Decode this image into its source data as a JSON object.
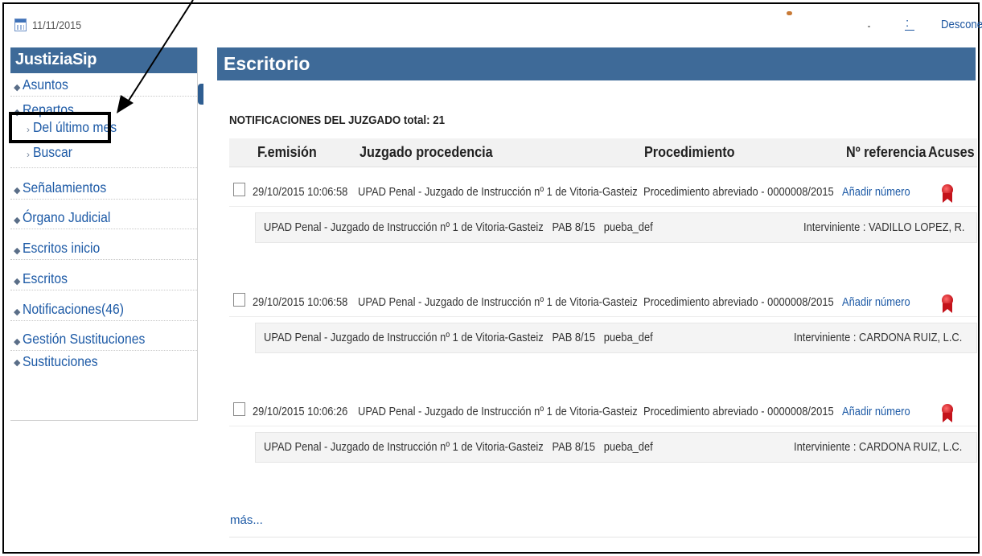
{
  "topbar": {
    "date": "11/11/2015",
    "link_short": ":",
    "logout": "Desconec"
  },
  "sidebar": {
    "title": "JustiziaSip",
    "items": [
      {
        "label": "Asuntos"
      },
      {
        "label": "Repartos"
      },
      {
        "label": "Señalamientos"
      },
      {
        "label": "Órgano Judicial"
      },
      {
        "label": "Escritos inicio"
      },
      {
        "label": "Escritos"
      },
      {
        "label": "Notificaciones(46)"
      },
      {
        "label": "Gestión Sustituciones"
      },
      {
        "label": "Sustituciones"
      }
    ],
    "subitems": [
      {
        "label": "Del último mes"
      },
      {
        "label": "Buscar"
      }
    ]
  },
  "main": {
    "title": "Escritorio",
    "section_title": "NOTIFICACIONES DEL JUZGADO total: 21",
    "columns": [
      "F.emisión",
      "Juzgado procedencia",
      "Procedimiento",
      "Nº referencia",
      "Acuses"
    ],
    "notifications": [
      {
        "date": "29/10/2015 10:06:58",
        "court": "UPAD Penal - Juzgado de Instrucción nº 1 de Vitoria-Gasteiz",
        "procedure": "Procedimiento abreviado - 0000008/2015",
        "reference": "Añadir número",
        "detail": "UPAD Penal - Juzgado de Instrucción nº 1 de Vitoria-Gasteiz   PAB 8/15   pueba_def",
        "participant": "Interviniente : VADILLO LOPEZ, R."
      },
      {
        "date": "29/10/2015 10:06:58",
        "court": "UPAD Penal - Juzgado de Instrucción nº 1 de Vitoria-Gasteiz",
        "procedure": "Procedimiento abreviado - 0000008/2015",
        "reference": "Añadir número",
        "detail": "UPAD Penal - Juzgado de Instrucción nº 1 de Vitoria-Gasteiz   PAB 8/15   pueba_def",
        "participant": "Interviniente : CARDONA RUIZ, L.C."
      },
      {
        "date": "29/10/2015 10:06:26",
        "court": "UPAD Penal - Juzgado de Instrucción nº 1 de Vitoria-Gasteiz",
        "procedure": "Procedimiento abreviado - 0000008/2015",
        "reference": "Añadir número",
        "detail": "UPAD Penal - Juzgado de Instrucción nº 1 de Vitoria-Gasteiz   PAB 8/15   pueba_def",
        "participant": "Interviniente : CARDONA RUIZ, L.C."
      }
    ],
    "more_link": "más..."
  },
  "colors": {
    "header_blue": "#3e6a98",
    "link_blue": "#1d5aa6",
    "acuse_red": "#c4121a"
  },
  "icons": [
    "calendar-icon",
    "bullet-icon",
    "chevron-right-icon",
    "collapse-arrow-icon",
    "acuse-ribbon-icon",
    "annotation-arrow-icon"
  ]
}
